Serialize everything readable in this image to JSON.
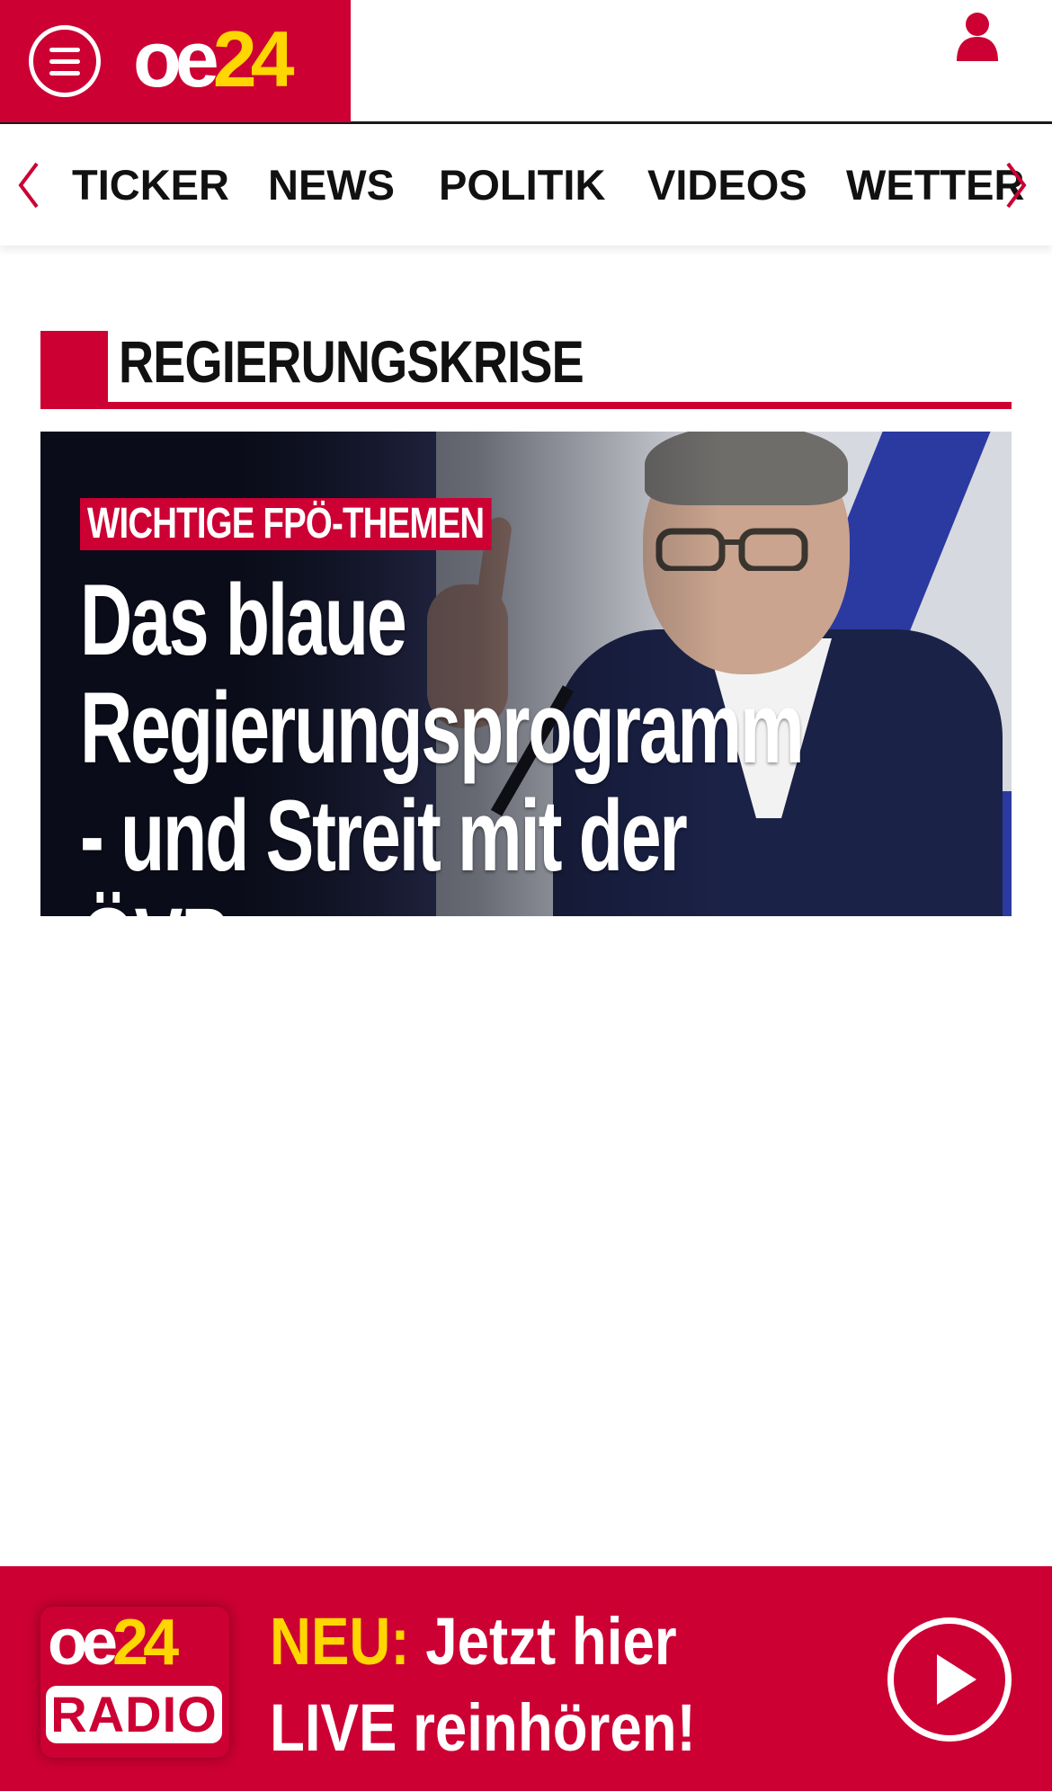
{
  "header": {
    "logo_oe": "oe",
    "logo_24": "24",
    "menu_icon": "hamburger-menu-icon",
    "user_icon": "user-account-icon"
  },
  "nav": {
    "prev_icon": "chevron-left-icon",
    "next_icon": "chevron-right-icon",
    "items": [
      "TICKER",
      "NEWS",
      "POLITIK",
      "VIDEOS",
      "WETTER"
    ]
  },
  "section": {
    "title": "REGIERUNGSKRISE"
  },
  "hero": {
    "kicker": "WICHTIGE FPÖ-THEMEN",
    "headline": "Das blaue Regierungsprogramm - und Streit mit der ÖVP"
  },
  "radio_banner": {
    "logo_oe": "oe",
    "logo_24": "24",
    "logo_radio": "RADIO",
    "new_label": "NEU:",
    "line1_rest": " Jetzt hier",
    "line2": "LIVE reinhören!",
    "play_icon": "play-icon"
  },
  "colors": {
    "brand_red": "#cc0033",
    "brand_yellow": "#ffd600"
  }
}
